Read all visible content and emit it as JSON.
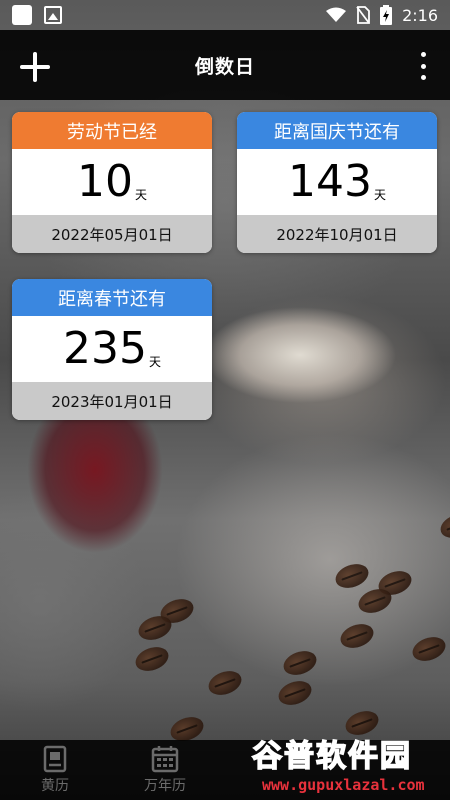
{
  "status_bar": {
    "time": "2:16"
  },
  "app_bar": {
    "title": "倒数日"
  },
  "cards": [
    {
      "title": "劳动节已经",
      "days": "10",
      "unit": "天",
      "date": "2022年05月01日",
      "header_color": "#ef7b31"
    },
    {
      "title": "距离国庆节还有",
      "days": "143",
      "unit": "天",
      "date": "2022年10月01日",
      "header_color": "#3a87e0"
    },
    {
      "title": "距离春节还有",
      "days": "235",
      "unit": "天",
      "date": "2023年01月01日",
      "header_color": "#3a87e0"
    }
  ],
  "bottom_nav": {
    "items": [
      {
        "label": "黄历",
        "icon": "almanac-icon"
      },
      {
        "label": "万年历",
        "icon": "calendar-icon"
      }
    ]
  },
  "watermark": {
    "brand": "谷普软件园",
    "url": "www.gupuxlazal.com"
  }
}
